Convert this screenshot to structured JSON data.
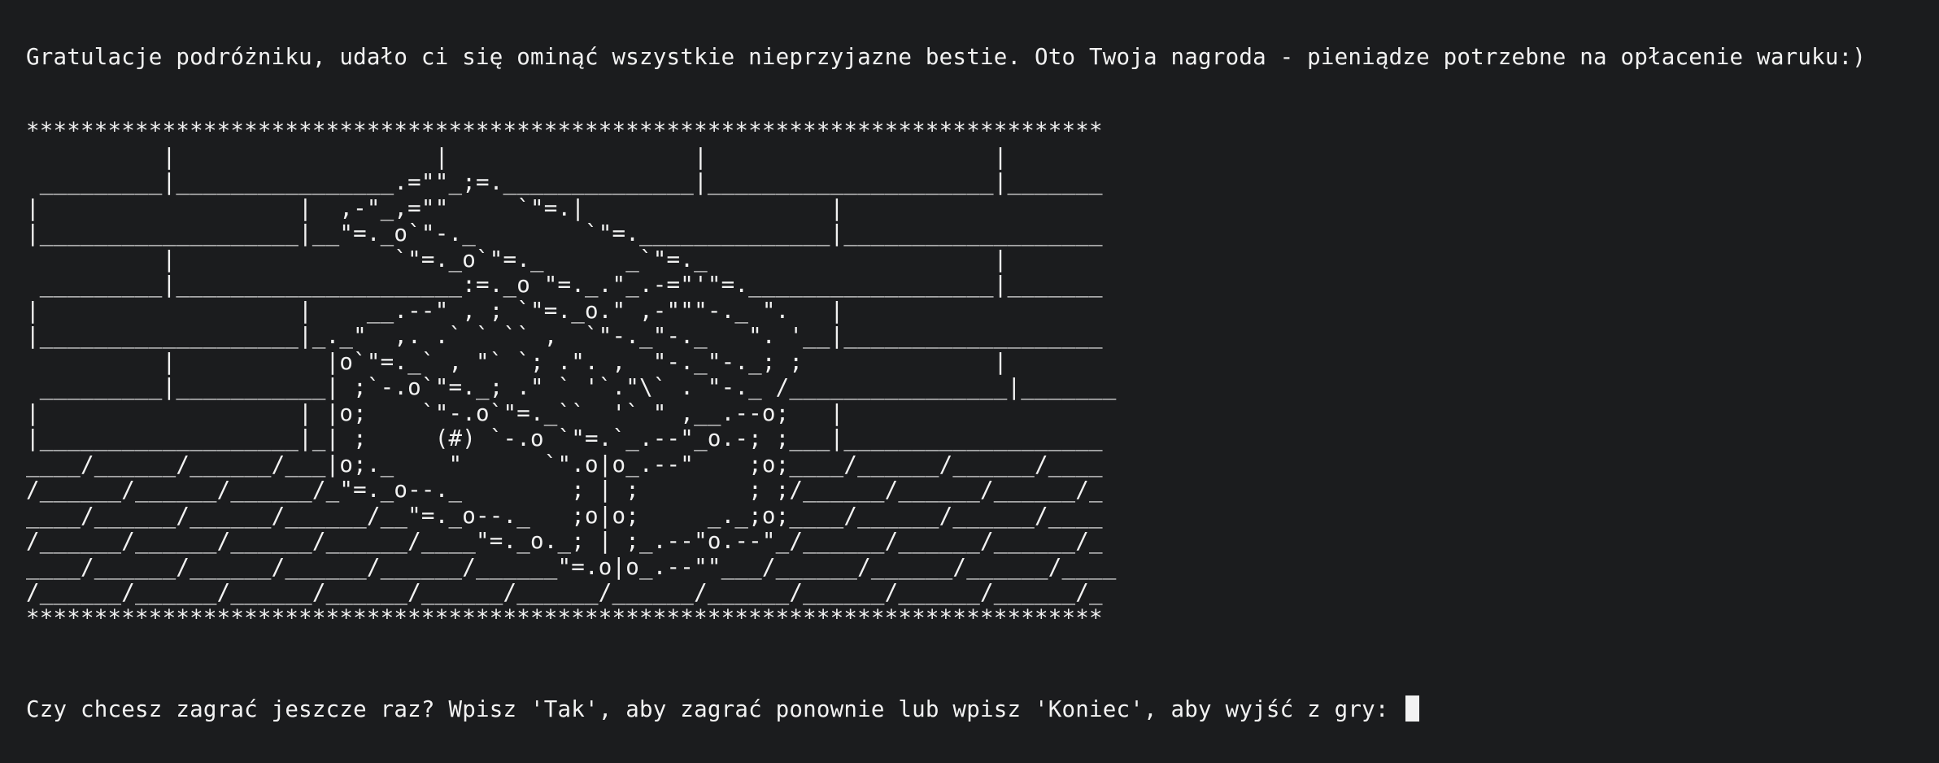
{
  "terminal": {
    "congrats_line": "Gratulacje podróżniku, udało ci się ominąć wszystkie nieprzyjazne bestie. Oto Twoja nagroda - pieniądze potrzebne na opłacenie waruku:)",
    "art": "*******************************************************************************\n          |                   |                  |                     |\n _________|________________.=\"\"_;=.______________|_____________________|_______\n|                   |  ,-\"_,=\"\"     `\"=.|                  |\n|___________________|__\"=._o`\"-._        `\"=.______________|___________________\n          |                `\"=._o`\"=._      _`\"=._                     |\n _________|_____________________:=._o \"=._.\"_.-=\"'\"=.__________________|_______\n|                   |    __.--\" , ; `\"=._o.\" ,-\"\"\"-._ \".   |\n|___________________|_._\"  ,. .` ` `` ,  `\"-._\"-._   \". '__|___________________\n          |           |o`\"=._` , \"` `; .\". ,  \"-._\"-._; ;              |\n _________|___________| ;`-.o`\"=._; .\" ` '`.\"\\` . \"-._ /________________|_______\n|                   | |o;    `\"-.o`\"=._``  '` \" ,__.--o;   |\n|___________________|_| ;     (#) `-.o `\"=.`_.--\"_o.-; ;___|___________________\n____/______/______/___|o;._    \"      `\".o|o_.--\"    ;o;____/______/______/____\n/______/______/______/_\"=._o--._        ; | ;        ; ;/______/______/______/_\n____/______/______/______/__\"=._o--._   ;o|o;     _._;o;____/______/______/____\n/______/______/______/______/____\"=._o._; | ;_.--\"o.--\"_/______/______/______/_\n____/______/______/______/______/______\"=.o|o_.--\"\"___/______/______/______/____\n/______/______/______/______/______/______/______/______/______/______/______/_\n*******************************************************************************",
    "prompt_line": "Czy chcesz zagrać jeszcze raz? Wpisz 'Tak', aby zagrać ponownie lub wpisz 'Koniec', aby wyjść z gry: ",
    "input_value": ""
  }
}
